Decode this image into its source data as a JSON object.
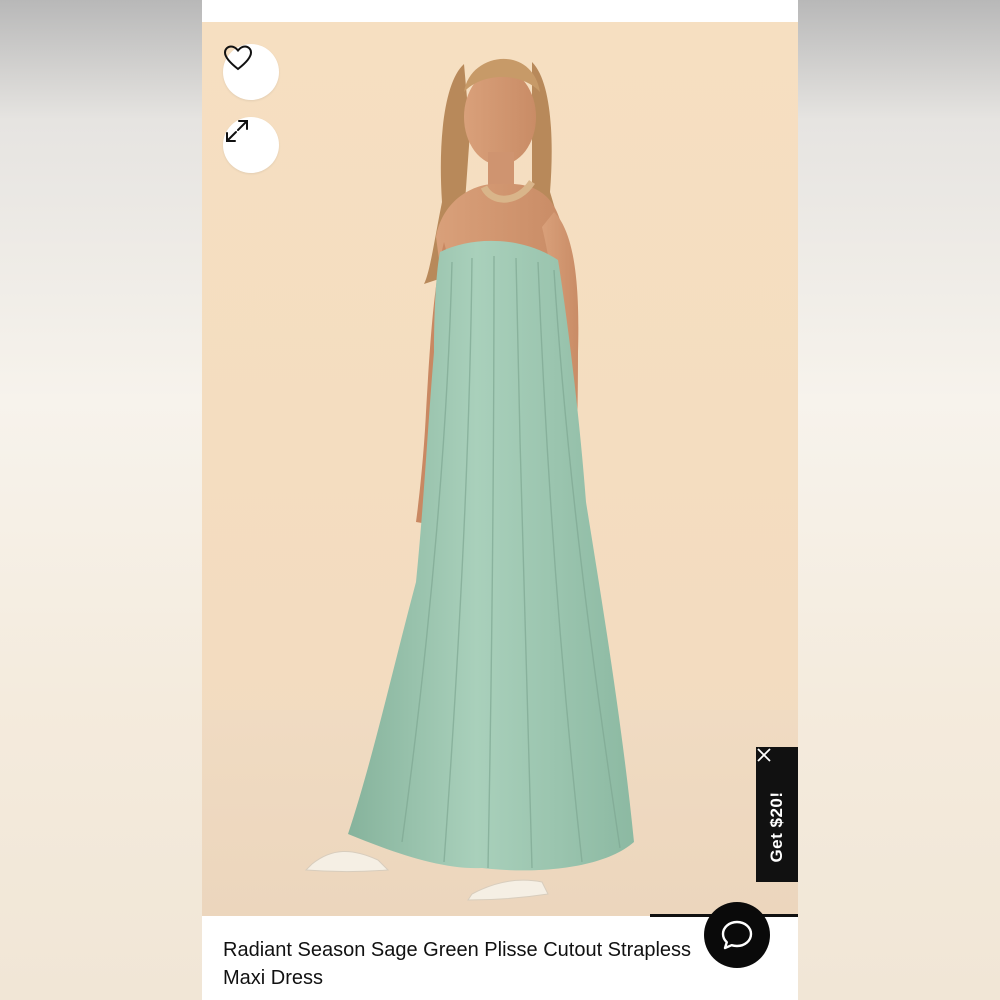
{
  "product": {
    "title": "Radiant Season Sage Green Plisse Cutout Strapless Maxi Dress",
    "image_alt": "Model wearing sage green strapless maxi dress"
  },
  "actions": {
    "favorite_icon": "heart-icon",
    "expand_icon": "expand-icon",
    "chat_icon": "chat-bubble-icon"
  },
  "promo": {
    "label": "Get $20!",
    "close_icon": "close-icon"
  },
  "colors": {
    "dress": "#9fc7b1",
    "backdrop": "#f4dcc1",
    "promo_bg": "#111111"
  }
}
